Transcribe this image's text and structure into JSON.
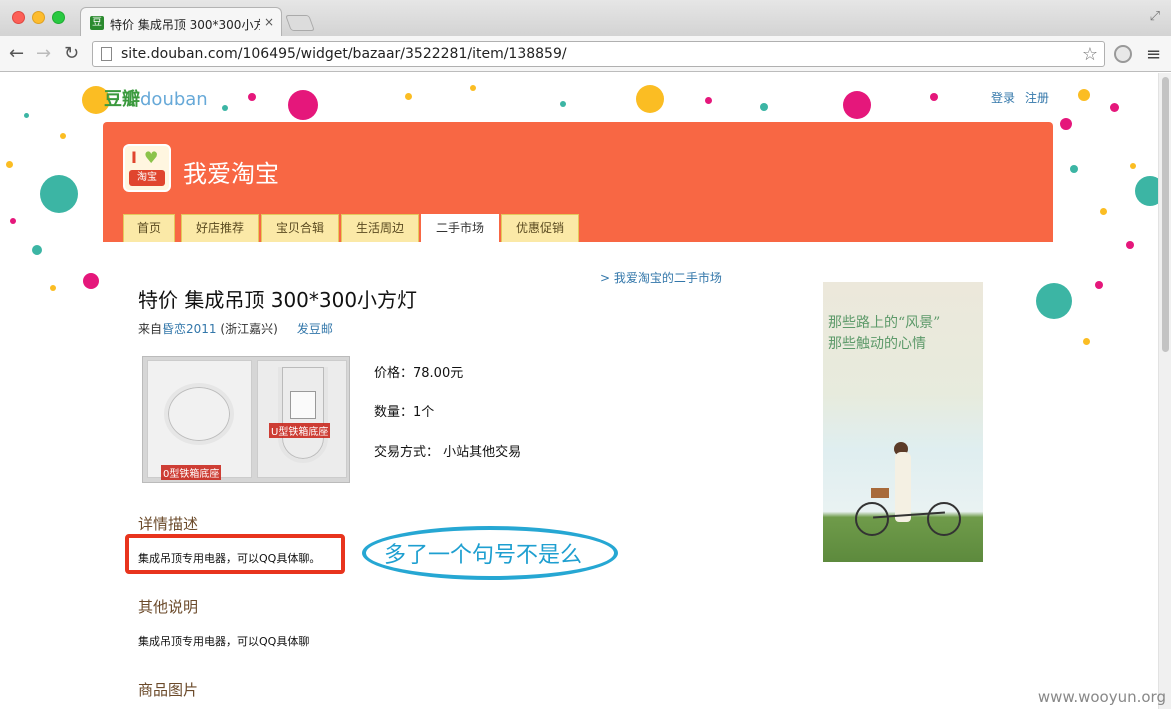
{
  "browser": {
    "tab_title": "特价 集成吊顶 300*300小方灯",
    "tab_close": "×",
    "favicon_text": "豆",
    "url": "site.douban.com/106495/widget/bazaar/3522281/item/138859/"
  },
  "header": {
    "logo_cn": "豆瓣",
    "logo_en": "douban",
    "login": "登录",
    "register": "注册"
  },
  "site": {
    "icon_i": "I",
    "icon_text": "淘宝",
    "name": "我爱淘宝",
    "tabs": [
      {
        "label": "首页"
      },
      {
        "label": "好店推荐"
      },
      {
        "label": "宝贝合辑"
      },
      {
        "label": "生活周边"
      },
      {
        "label": "二手市场"
      },
      {
        "label": "优惠促销"
      }
    ],
    "active_tab": "二手市场"
  },
  "item": {
    "breadcrumb": "> 我爱淘宝的二手市场",
    "title": "特价 集成吊顶 300*300小方灯",
    "from_prefix": "来自",
    "seller": "昏恋2011",
    "location": "(浙江嘉兴)",
    "mail_link": "发豆邮",
    "photo_label_left": "0型铁箱底座",
    "photo_label_right": "U型铁箱底座",
    "price": "价格：78.00元",
    "quantity": "数量：1个",
    "trade": "交易方式：  小站其他交易"
  },
  "sections": {
    "detail_title": "详情描述",
    "detail_body": "集成吊顶专用电器，可以QQ具体聊。",
    "other_title": "其他说明",
    "other_body": "集成吊顶专用电器，可以QQ具体聊",
    "images_title": "商品图片"
  },
  "annotation": {
    "callout": "多了一个句号不是么"
  },
  "ad": {
    "line1": "那些路上的“风景”",
    "line2": "那些触动的心情"
  },
  "watermark": "www.wooyun.org",
  "colors": {
    "banner": "#f86744",
    "tab": "#fbe9a7",
    "link": "#3377aa",
    "annotation_red": "#e8341d",
    "annotation_blue": "#26a7d3"
  }
}
